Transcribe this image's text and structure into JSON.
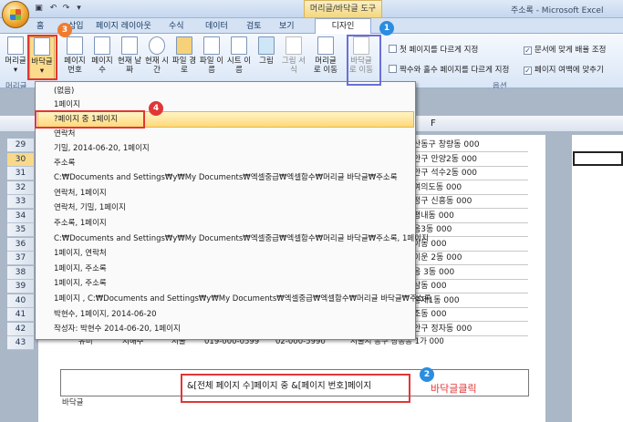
{
  "window": {
    "context_tab": "머리글/바닥글 도구",
    "title": "주소록 - Microsoft Excel"
  },
  "tabs": [
    "홈",
    "삽입",
    "페이지 레이아웃",
    "수식",
    "데이터",
    "검토",
    "보기"
  ],
  "active_tab": "디자인",
  "ribbon": {
    "buttons": {
      "header": "머리글",
      "footer": "바닥글",
      "page_number": "페이지 번호",
      "page_count": "페이지 수",
      "current_date": "현재 날짜",
      "current_time": "현재 시간",
      "file_path": "파일 경로",
      "file_name": "파일 이름",
      "sheet_name": "시트 이름",
      "picture": "그림",
      "format_picture": "그림 서식",
      "goto_header": "머리글로 이동",
      "goto_footer": "바닥글로 이동"
    },
    "group_header_footer": "머리글",
    "group_options": "옵션",
    "options": [
      {
        "label": "첫 페이지를 다르게 지정",
        "checked": false
      },
      {
        "label": "짝수와 홀수 페이지를 다르게 지정",
        "checked": false
      },
      {
        "label": "문서에 맞게 배율 조정",
        "checked": true
      },
      {
        "label": "페이지 여백에 맞추기",
        "checked": true
      }
    ]
  },
  "sheet": {
    "column_header": "F",
    "row_numbers": [
      "29",
      "30",
      "31",
      "32",
      "33",
      "34",
      "35",
      "36",
      "37",
      "38",
      "39",
      "40",
      "41",
      "42",
      "43"
    ],
    "selected_row": "30",
    "column_f": [
      "산동구 창량동 000",
      "안구 안양2동 000",
      "안구 석수2동 000",
      "여의도동 000",
      "정구 신흥동 000",
      "평내동 000",
      "음3동 000",
      "이동 000",
      "이운 2동 000",
      "음 3동 000",
      "삼동 000",
      "홍제1동 000",
      "조동 000",
      "안구 정자동 000"
    ],
    "last_row": [
      "유미",
      "지해주",
      "서울",
      "019-000-0599",
      "02-000-5990",
      "서울시 종구 창봉동 1가 000"
    ],
    "footer_field": "&[전체 페이지 수]페이지 중 &[페이지 번호]페이지",
    "footer_label": "바닥글"
  },
  "dropdown": {
    "items": [
      "(없음)",
      "1페이지",
      "?페이지 중 1페이지",
      "연락처",
      " 기밀, 2014-06-20, 1페이지",
      "주소록",
      "C:₩Documents and Settings₩y₩My Documents₩엑셀중급₩엑셀함수₩머리글 바닥글₩주소록",
      "연락처, 1페이지",
      "연락처,  기밀, 1페이지",
      "주소록, 1페이지",
      "C:₩Documents and Settings₩y₩My Documents₩엑셀중급₩엑셀함수₩머리글 바닥글₩주소록, 1페이지",
      "1페이지, 연락처",
      "1페이지, 주소록",
      "1페이지, 주소록",
      "1페이지 , C:₩Documents and Settings₩y₩My Documents₩엑셀중급₩엑셀함수₩머리글 바닥글₩주소록",
      "박현수, 1페이지, 2014-06-20",
      "작성자: 박현수 2014-06-20, 1페이지"
    ],
    "highlighted_index": 2
  },
  "annotations": {
    "m1": "1",
    "m2": "2",
    "m3": "3",
    "m4": "4",
    "footer_click": "바닥글클릭",
    "colors": {
      "red": "#e23636",
      "blue": "#2b8de0",
      "orange": "#f07b2e"
    }
  }
}
